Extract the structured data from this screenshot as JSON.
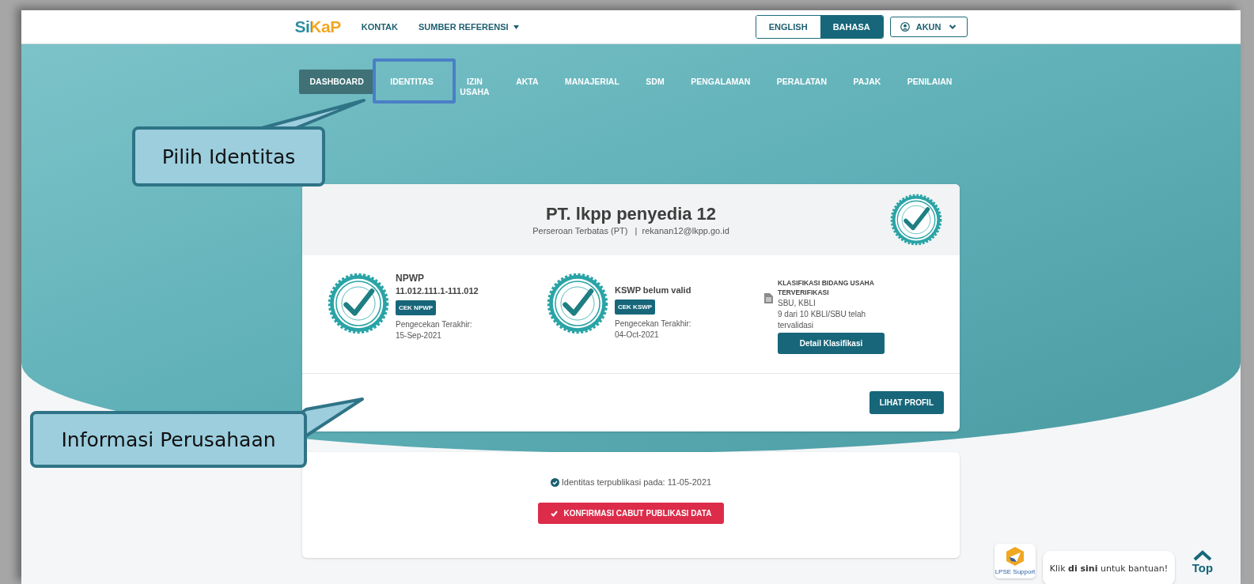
{
  "header": {
    "logo": "SiKaP",
    "links": [
      {
        "label": "KONTAK",
        "kind": "link"
      },
      {
        "label": "SUMBER REFERENSI",
        "kind": "dropdown"
      }
    ],
    "languages": [
      {
        "label": "ENGLISH",
        "selected": false
      },
      {
        "label": "BAHASA",
        "selected": true
      }
    ],
    "account": "AKUN"
  },
  "tabs": [
    {
      "label": "DASHBOARD",
      "selected": true
    },
    {
      "label": "IDENTITAS",
      "selected": false
    },
    {
      "label": "IZIN USAHA",
      "selected": false
    },
    {
      "label": "AKTA",
      "selected": false
    },
    {
      "label": "MANAJERIAL",
      "selected": false
    },
    {
      "label": "SDM",
      "selected": false
    },
    {
      "label": "PENGALAMAN",
      "selected": false
    },
    {
      "label": "PERALATAN",
      "selected": false
    },
    {
      "label": "PAJAK",
      "selected": false
    },
    {
      "label": "PENILAIAN",
      "selected": false
    }
  ],
  "company": {
    "name": "PT. lkpp penyedia 12",
    "subtitle": "Perseroan Terbatas (PT)   |  rekanan12@lkpp.go.id",
    "npwp": {
      "title": "NPWP",
      "value": "11.012.111.1-111.012",
      "button": "CEK NPWP",
      "checked_label": "Pengecekan Terakhir:",
      "checked_date": "15-Sep-2021"
    },
    "kswp": {
      "title": "KSWP belum valid",
      "button": "CEK KSWP",
      "checked_label": "Pengecekan Terakhir:",
      "checked_date": "04-Oct-2021"
    },
    "klasifikasi": {
      "title": "KLASIFIKASI BIDANG USAHA TERVERIFIKASI",
      "types": "SBU, KBLI",
      "note": "9 dari 10 KBLI/SBU telah tervalidasi",
      "button": "Detail Klasifikasi"
    },
    "profile_button": "LIHAT PROFIL"
  },
  "publication": {
    "status": "Identitas terpublikasi pada: 11-05-2021",
    "button": "KONFIRMASI CABUT PUBLIKASI DATA"
  },
  "help": {
    "logo_caption": "LPSE Support",
    "message": "Klik **di sini** untuk bantuan!",
    "top": "Top"
  },
  "annotations": [
    {
      "kind": "callout",
      "text": "Pilih Identitas"
    },
    {
      "kind": "callout",
      "text": "Informasi Perusahaan"
    },
    {
      "kind": "highlight"
    }
  ]
}
